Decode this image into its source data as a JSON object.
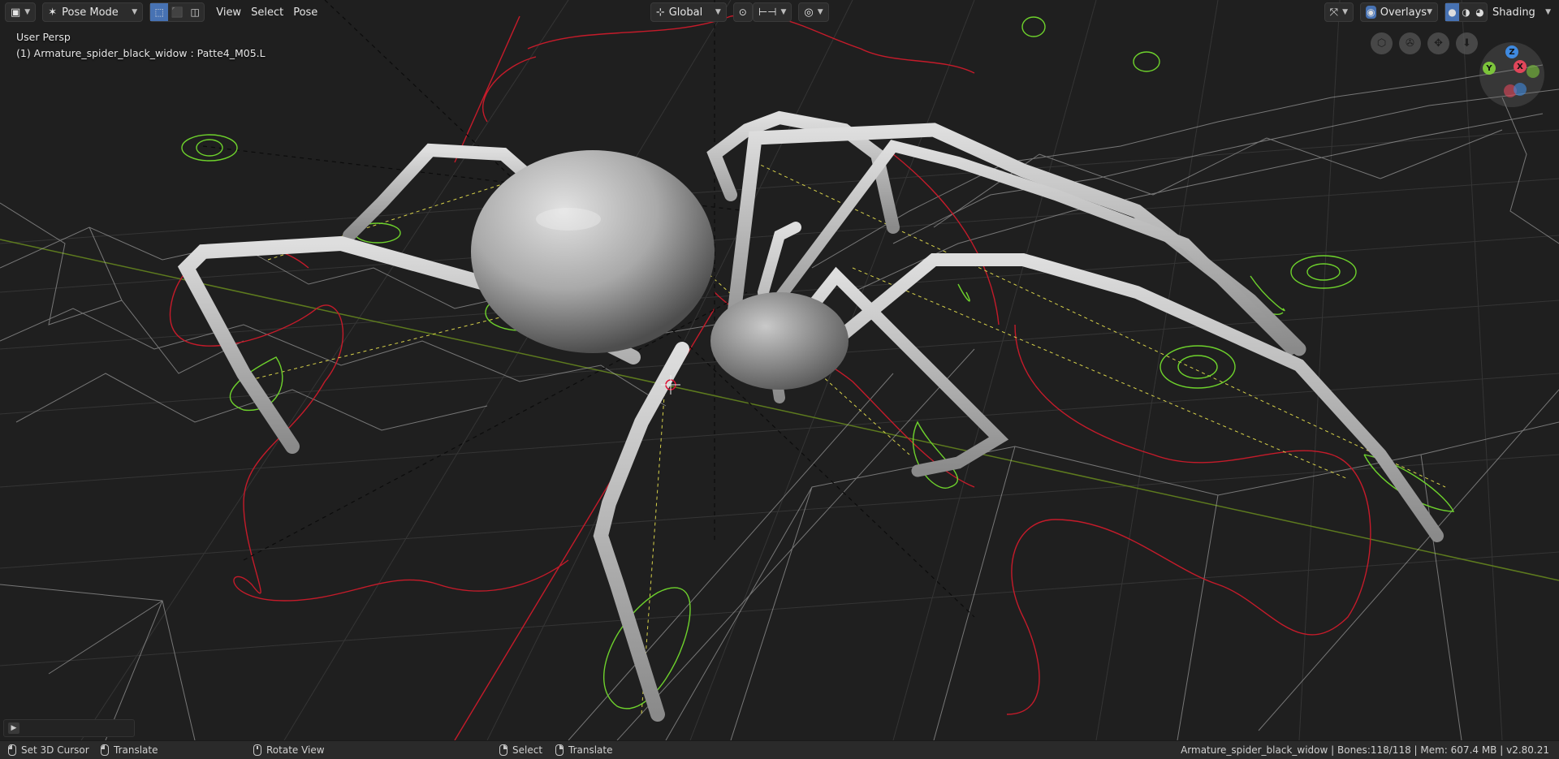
{
  "header": {
    "editor_type_icon": "3d-viewport-icon",
    "mode": "Pose Mode",
    "menus": [
      "View",
      "Select",
      "Pose"
    ],
    "transform_orientation": "Global",
    "overlays_label": "Overlays",
    "shading_label": "Shading"
  },
  "viewport": {
    "view_name": "User Persp",
    "object_info": "(1) Armature_spider_black_widow : Patte4_M05.L"
  },
  "gizmo": {
    "axes": {
      "z": "Z",
      "y": "Y",
      "x": "X"
    },
    "colors": {
      "x": "#e0465a",
      "y": "#7cc43b",
      "z": "#3f8ae0"
    }
  },
  "statusbar": {
    "left_click": "Set 3D Cursor",
    "left_drag": "Translate",
    "middle": "Rotate View",
    "select": "Select",
    "select_drag": "Translate",
    "stats": "Armature_spider_black_widow | Bones:118/118 | Mem: 607.4 MB | v2.80.21"
  },
  "colors": {
    "background": "#1f1f1f",
    "accent": "#4772b3",
    "controller_green": "#6ed22c",
    "curve_red": "#c51b2a",
    "grid": "#3a3a3a"
  }
}
